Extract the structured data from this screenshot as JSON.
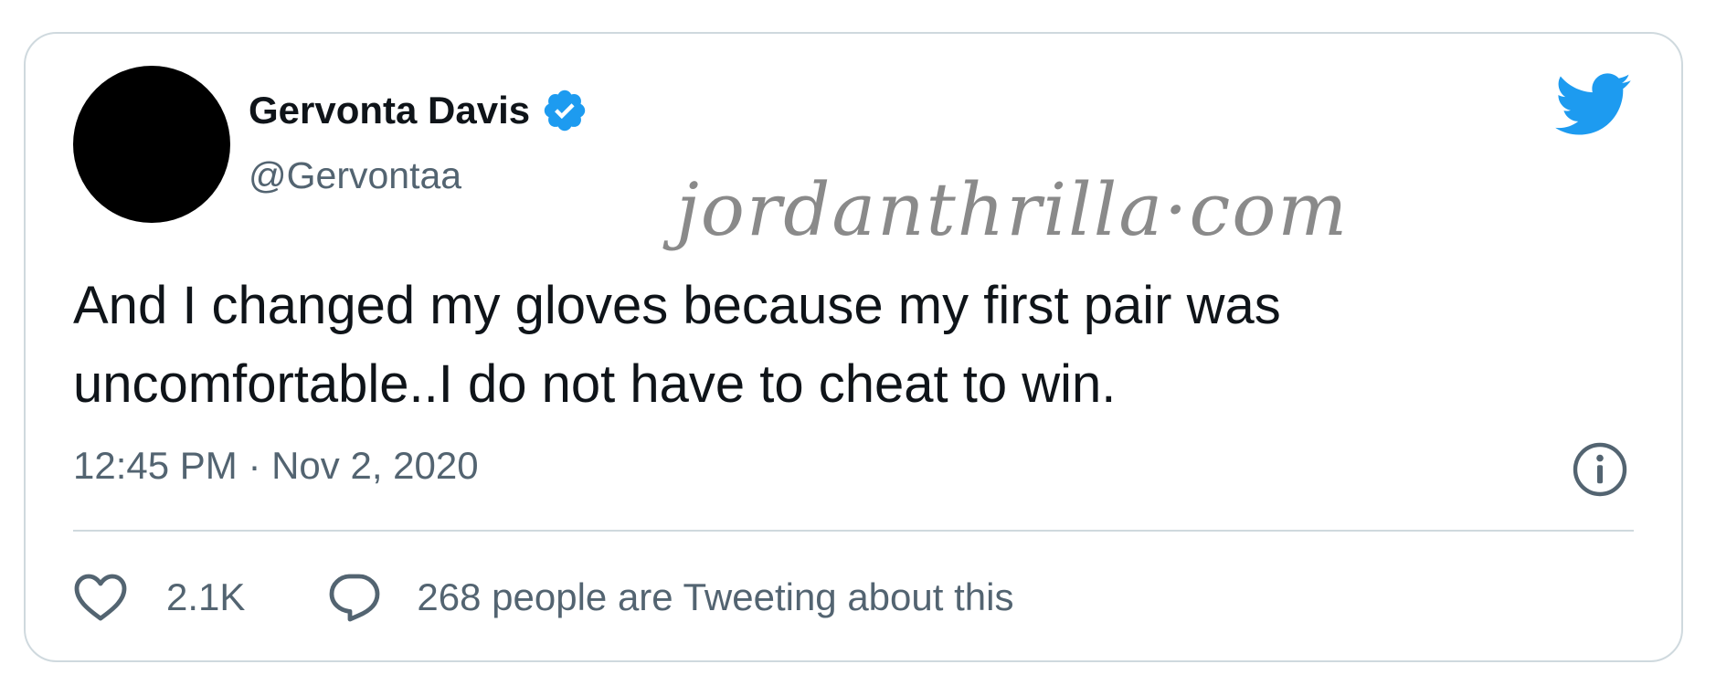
{
  "tweet": {
    "display_name": "Gervonta Davis",
    "handle": "@Gervontaa",
    "verified": true,
    "text": "And I changed my gloves because my first pair was uncomfortable..I do not have to cheat to win.",
    "timestamp": "12:45 PM · Nov 2, 2020",
    "likes": "2.1K",
    "tweeting_about": "268 people are Tweeting about this"
  },
  "watermark": "jordanthrilla·com",
  "icons": {
    "verified": "verified-badge-icon",
    "brand": "twitter-bird-icon",
    "info": "info-icon",
    "like": "heart-icon",
    "reply": "speech-bubble-icon"
  },
  "colors": {
    "brand_blue": "#1d9bf0",
    "text_primary": "#0f1419",
    "text_secondary": "#536471",
    "border": "#cfd9de",
    "avatar": "#000000",
    "watermark": "#8a8a8a"
  }
}
